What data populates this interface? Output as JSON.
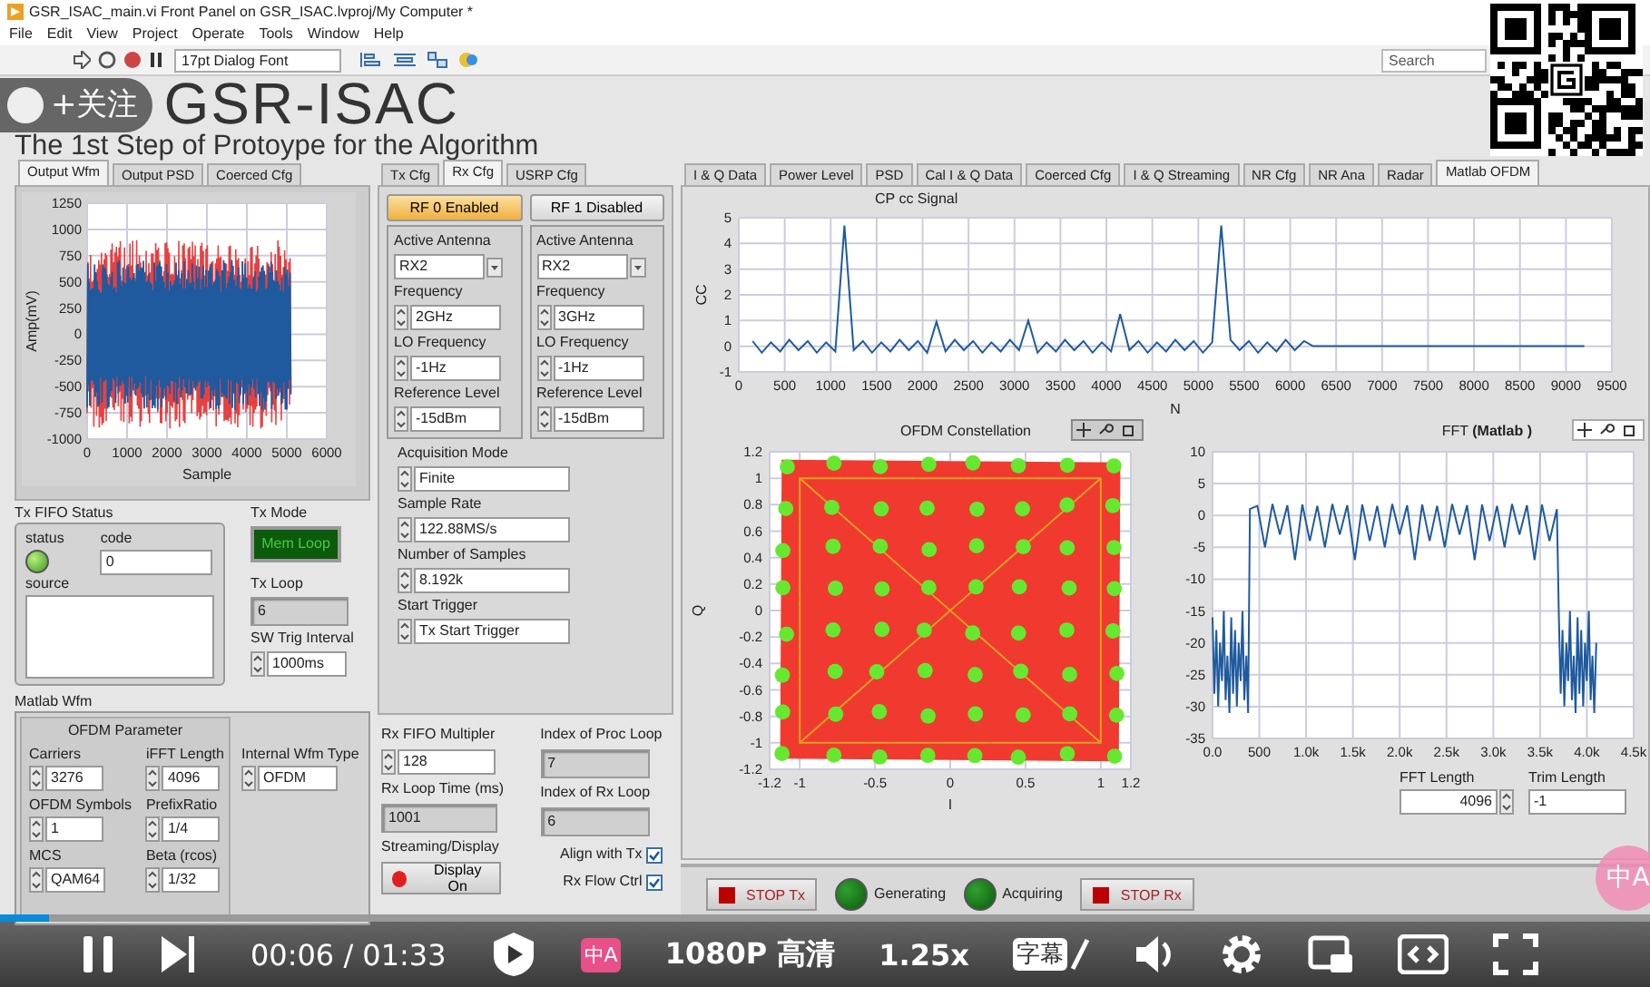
{
  "window": {
    "title": "GSR_ISAC_main.vi Front Panel on GSR_ISAC.lvproj/My Computer *"
  },
  "menu": [
    "File",
    "Edit",
    "View",
    "Project",
    "Operate",
    "Tools",
    "Window",
    "Help"
  ],
  "toolbar": {
    "font": "17pt Dialog Font",
    "search_placeholder": "Search"
  },
  "header": {
    "title": "GSR-ISAC",
    "subtitle": "The 1st Step of Protoype for the Algorithm"
  },
  "follow_button": {
    "label": "+关注"
  },
  "left_tabs": [
    {
      "label": "Output Wfm",
      "selected": true
    },
    {
      "label": "Output PSD",
      "selected": false
    },
    {
      "label": "Coerced Cfg",
      "selected": false
    }
  ],
  "output_chart": {
    "xlabel": "Sample",
    "ylabel": "Amp(mV)",
    "xticks": [
      "0",
      "1000",
      "2000",
      "3000",
      "4000",
      "5000",
      "6000"
    ],
    "yticks": [
      "1250",
      "1000",
      "750",
      "500",
      "250",
      "0",
      "-250",
      "-500",
      "-750",
      "-1000"
    ]
  },
  "tx_fifo": {
    "title": "Tx FIFO Status",
    "status_label": "status",
    "status_ok": true,
    "code_label": "code",
    "code": "0",
    "source_label": "source"
  },
  "tx_mode": {
    "label": "Tx Mode",
    "value": "Mem Loop"
  },
  "tx_loop": {
    "label": "Tx Loop",
    "value": "6"
  },
  "sw_trig": {
    "label": "SW Trig Interval",
    "value": "1000ms"
  },
  "matlab_wfm": {
    "title": "Matlab Wfm",
    "group_title": "OFDM Parameter",
    "fields": [
      {
        "label": "Carriers",
        "value": "3276"
      },
      {
        "label": "iFFT Length",
        "value": "4096"
      },
      {
        "label": "OFDM Symbols",
        "value": "1"
      },
      {
        "label": "PrefixRatio",
        "value": "1/4"
      },
      {
        "label": "MCS",
        "value": "QAM64"
      },
      {
        "label": "Beta (rcos)",
        "value": "1/32"
      }
    ],
    "wfm_type": {
      "label": "Internal Wfm Type",
      "value": "OFDM"
    }
  },
  "mid_tabs": [
    {
      "label": "Tx Cfg",
      "selected": false
    },
    {
      "label": "Rx Cfg",
      "selected": true
    },
    {
      "label": "USRP Cfg",
      "selected": false
    }
  ],
  "rf_channels": [
    {
      "button": "RF 0 Enabled",
      "on": true,
      "antenna_label": "Active Antenna",
      "antenna": "RX2",
      "fields": [
        {
          "label": "Frequency",
          "value": "2GHz"
        },
        {
          "label": "LO Frequency",
          "value": "-1Hz"
        },
        {
          "label": "Reference Level",
          "value": "-15dBm"
        }
      ]
    },
    {
      "button": "RF 1 Disabled",
      "on": false,
      "antenna_label": "Active Antenna",
      "antenna": "RX2",
      "fields": [
        {
          "label": "Frequency",
          "value": "3GHz"
        },
        {
          "label": "LO Frequency",
          "value": "-1Hz"
        },
        {
          "label": "Reference Level",
          "value": "-15dBm"
        }
      ]
    }
  ],
  "acquisition": [
    {
      "label": "Acquisition Mode",
      "value": "Finite"
    },
    {
      "label": "Sample Rate",
      "value": "122.88MS/s"
    },
    {
      "label": "Number of Samples",
      "value": "8.192k"
    },
    {
      "label": "Start Trigger",
      "value": "Tx Start Trigger"
    }
  ],
  "rx_loop": {
    "fifo_label": "Rx FIFO Multipler",
    "fifo": "128",
    "proc_label": "Index of Proc Loop",
    "proc": "7",
    "time_label": "Rx Loop Time (ms)",
    "time": "1001",
    "index_label": "Index of Rx Loop",
    "index": "6"
  },
  "streaming": {
    "label": "Streaming/Display",
    "button": "Display On",
    "on": true
  },
  "options": [
    {
      "label": "Align with Tx",
      "checked": true
    },
    {
      "label": "Rx Flow Ctrl",
      "checked": true
    }
  ],
  "right_tabs": [
    {
      "label": "I & Q Data",
      "selected": false
    },
    {
      "label": "Power Level",
      "selected": false
    },
    {
      "label": "PSD",
      "selected": false
    },
    {
      "label": "Cal I & Q Data",
      "selected": false
    },
    {
      "label": "Coerced Cfg",
      "selected": false
    },
    {
      "label": "I & Q Streaming",
      "selected": false
    },
    {
      "label": "NR Cfg",
      "selected": false
    },
    {
      "label": "NR Ana",
      "selected": false
    },
    {
      "label": "Radar",
      "selected": false
    },
    {
      "label": "Matlab OFDM",
      "selected": true
    }
  ],
  "cc_chart": {
    "chart_data": {
      "type": "line",
      "title": "CP cc Signal",
      "xlabel": "N",
      "ylabel": "CC",
      "x": [
        150,
        250,
        350,
        450,
        550,
        650,
        750,
        850,
        950,
        1050,
        1150,
        1250,
        1350,
        1450,
        1550,
        1650,
        1750,
        1850,
        1950,
        2050,
        2150,
        2250,
        2350,
        2450,
        2550,
        2650,
        2750,
        2850,
        2950,
        3050,
        3150,
        3250,
        3350,
        3450,
        3550,
        3650,
        3750,
        3850,
        3950,
        4050,
        4150,
        4250,
        4350,
        4450,
        4550,
        4650,
        4750,
        4850,
        4950,
        5050,
        5150,
        5250,
        5350,
        5450,
        5550,
        5650,
        5750,
        5850,
        5950,
        6050,
        6150,
        6250,
        9200
      ],
      "series": [
        {
          "color": "#1f5a9e",
          "values": [
            0.2,
            -0.25,
            0.15,
            -0.2,
            0.25,
            -0.15,
            0.2,
            -0.25,
            0.15,
            -0.2,
            4.7,
            -0.15,
            0.2,
            -0.25,
            0.15,
            -0.2,
            0.25,
            -0.15,
            0.2,
            -0.25,
            0.95,
            -0.2,
            0.25,
            -0.15,
            0.2,
            -0.25,
            0.15,
            -0.2,
            0.25,
            -0.15,
            1.0,
            -0.25,
            0.15,
            -0.2,
            0.25,
            -0.15,
            0.2,
            -0.25,
            0.15,
            -0.2,
            1.25,
            -0.15,
            0.2,
            -0.25,
            0.15,
            -0.2,
            0.25,
            -0.15,
            0.2,
            -0.25,
            0.15,
            4.7,
            0.25,
            -0.15,
            0.2,
            -0.25,
            0.15,
            -0.2,
            0.25,
            -0.15,
            0.2,
            0,
            0
          ]
        }
      ],
      "xlim": [
        0,
        9500
      ],
      "ylim": [
        -1,
        5
      ],
      "grid": true,
      "xticks": [
        0,
        500,
        1000,
        1500,
        2000,
        2500,
        3000,
        3500,
        4000,
        4500,
        5000,
        5500,
        6000,
        6500,
        7000,
        7500,
        8000,
        8500,
        9000,
        9500
      ],
      "yticks": [
        -1,
        0,
        1,
        2,
        3,
        4,
        5
      ]
    }
  },
  "constellation": {
    "title": "OFDM Constellation",
    "xlabel": "I",
    "ylabel": "Q",
    "xticks": [
      "-1.2",
      "-1",
      "-0.5",
      "0",
      "0.5",
      "1",
      "1.2"
    ],
    "yticks": [
      "1.2",
      "1",
      "0.8",
      "0.6",
      "0.4",
      "0.2",
      "0",
      "-0.2",
      "-0.4",
      "-0.6",
      "-0.8",
      "-1",
      "-1.2"
    ]
  },
  "fft_chart": {
    "chart_data": {
      "type": "line",
      "title": "FFT  **(Matlab )**",
      "x": [
        0,
        20,
        40,
        60,
        80,
        100,
        120,
        140,
        160,
        180,
        200,
        220,
        240,
        260,
        280,
        300,
        320,
        340,
        360,
        380,
        400,
        480,
        560,
        640,
        720,
        800,
        880,
        960,
        1040,
        1120,
        1200,
        1280,
        1360,
        1440,
        1520,
        1600,
        1680,
        1760,
        1840,
        1920,
        2000,
        2080,
        2160,
        2240,
        2320,
        2400,
        2480,
        2560,
        2640,
        2720,
        2800,
        2880,
        2960,
        3040,
        3120,
        3200,
        3280,
        3360,
        3440,
        3520,
        3600,
        3680,
        3700,
        3720,
        3740,
        3760,
        3780,
        3800,
        3820,
        3840,
        3860,
        3880,
        3900,
        3920,
        3940,
        3960,
        3980,
        4000,
        4020,
        4040,
        4060,
        4080,
        4100
      ],
      "series": [
        {
          "color": "#1f5a9e",
          "values": [
            -16,
            -28,
            -18,
            -30,
            -20,
            -26,
            -15,
            -29,
            -22,
            -31,
            -16,
            -28,
            -18,
            -30,
            -20,
            -26,
            -15,
            -29,
            -22,
            -31,
            1,
            1.5,
            -5,
            1.8,
            -3,
            1.6,
            -7,
            1.7,
            -4,
            1.5,
            -5,
            1.8,
            -3,
            1.6,
            -7,
            1.7,
            -4,
            1.5,
            -5,
            1.8,
            -3,
            1.6,
            -7,
            1.7,
            -4,
            1.5,
            -5,
            1.8,
            -3,
            1.6,
            -7,
            1.7,
            -4,
            1.5,
            -5,
            1.8,
            -3,
            1.6,
            -7,
            1.7,
            -4,
            1,
            -16,
            -28,
            -18,
            -30,
            -20,
            -26,
            -15,
            -29,
            -22,
            -31,
            -16,
            -28,
            -18,
            -30,
            -20,
            -26,
            -15,
            -29,
            -22,
            -31,
            -20
          ]
        }
      ],
      "xlim": [
        0,
        4500
      ],
      "ylim": [
        -35,
        10
      ],
      "grid": true,
      "xticks": [
        {
          "value": 0,
          "label": "0.0"
        },
        500,
        {
          "value": 1000,
          "label": "1.0k"
        },
        {
          "value": 1500,
          "label": "1.5k"
        },
        {
          "value": 2000,
          "label": "2.0k"
        },
        {
          "value": 2500,
          "label": "2.5k"
        },
        {
          "value": 3000,
          "label": "3.0k"
        },
        {
          "value": 3500,
          "label": "3.5k"
        },
        {
          "value": 4000,
          "label": "4.0k"
        },
        {
          "value": 4500,
          "label": "4.5k"
        }
      ],
      "yticks": [
        -35,
        -30,
        -25,
        -20,
        -15,
        -10,
        -5,
        0,
        5,
        10
      ]
    }
  },
  "fft_length": {
    "label": "FFT Length",
    "value": "4096"
  },
  "trim_length": {
    "label": "Trim Length",
    "value": "-1"
  },
  "status_controls": [
    {
      "kind": "stop",
      "label": "STOP Tx"
    },
    {
      "kind": "led",
      "label": "Generating",
      "on": true
    },
    {
      "kind": "led",
      "label": "Acquiring",
      "on": true
    },
    {
      "kind": "stop",
      "label": "STOP Rx"
    }
  ],
  "player": {
    "level": 0.03,
    "time": "00:06 / 01:33",
    "translate": "中A",
    "quality": "1080P 高清",
    "speed": "1.25x",
    "subtitles": "字幕",
    "subtitles_on": false,
    "side_badge": "中A"
  }
}
